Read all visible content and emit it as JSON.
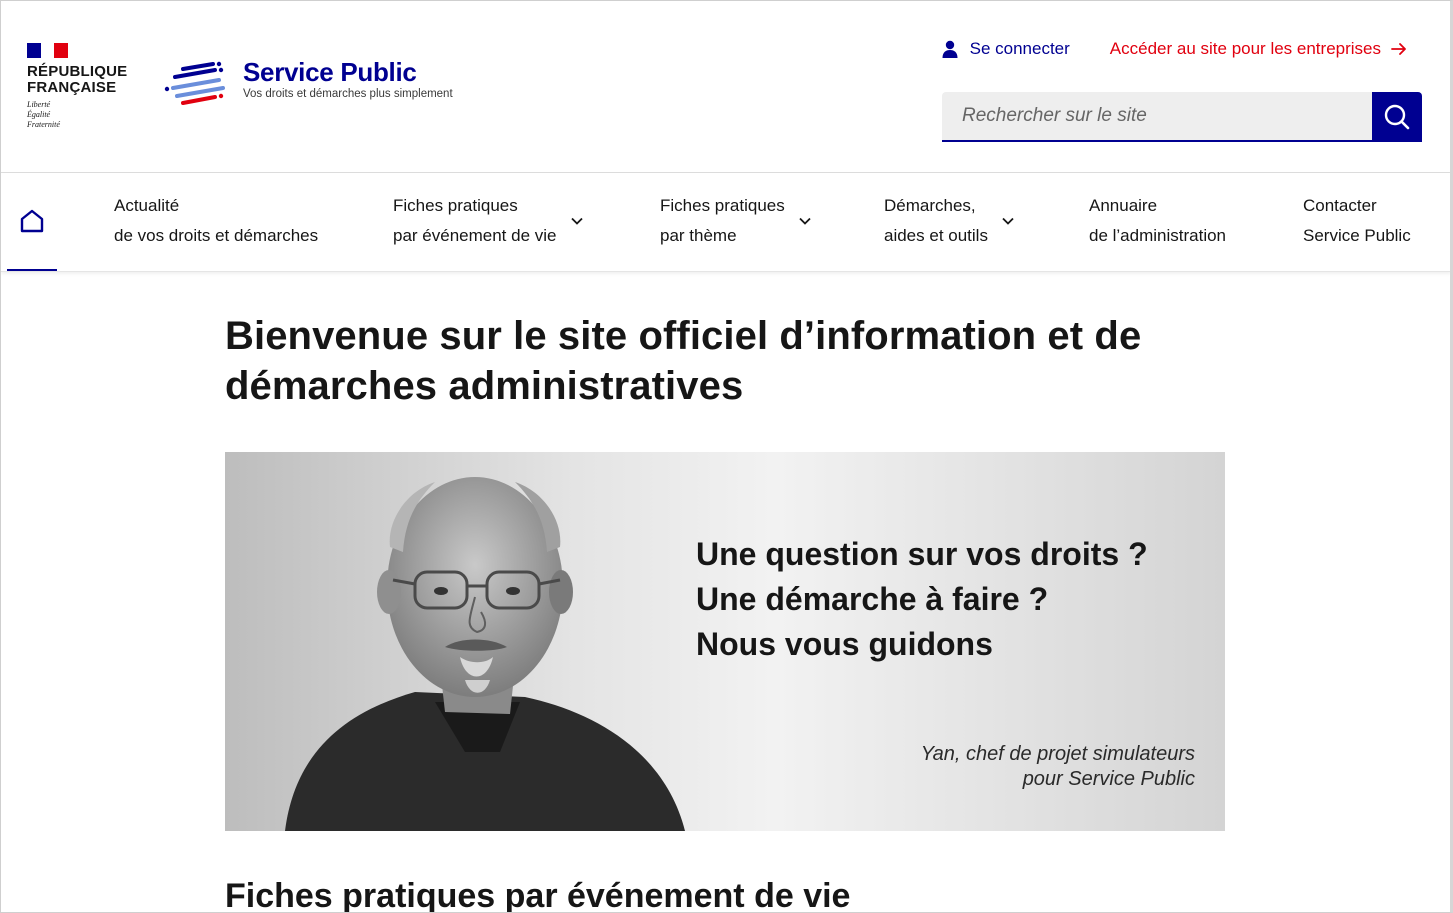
{
  "header": {
    "republic_line1": "RÉPUBLIQUE",
    "republic_line2": "FRANÇAISE",
    "motto": [
      "Liberté",
      "Égalité",
      "Fraternité"
    ],
    "site_name": "Service Public",
    "tagline": "Vos droits et démarches plus simplement",
    "connect_label": "Se connecter",
    "business_label": "Accéder au site pour les entreprises",
    "search_placeholder": "Rechercher sur le site"
  },
  "nav": {
    "items": [
      {
        "line1": "Actualité",
        "line2": "de vos droits et démarches",
        "has_dropdown": false
      },
      {
        "line1": "Fiches pratiques",
        "line2": "par événement de vie",
        "has_dropdown": true
      },
      {
        "line1": "Fiches pratiques",
        "line2": "par thème",
        "has_dropdown": true
      },
      {
        "line1": "Démarches,",
        "line2": "aides et outils",
        "has_dropdown": true
      },
      {
        "line1": "Annuaire",
        "line2": "de l’administration",
        "has_dropdown": false
      },
      {
        "line1": "Contacter",
        "line2": "Service Public",
        "has_dropdown": false
      }
    ]
  },
  "main": {
    "title": "Bienvenue sur le site officiel d’information et de démarches administratives",
    "banner": {
      "lines": [
        "Une question sur vos droits ?",
        "Une démarche à faire ?",
        "Nous vous guidons"
      ],
      "caption_line1": "Yan, chef de projet simulateurs",
      "caption_line2": "pour Service Public"
    },
    "section_title": "Fiches pratiques par événement de vie"
  },
  "colors": {
    "brand_blue": "#000091",
    "brand_red": "#e1000f"
  }
}
